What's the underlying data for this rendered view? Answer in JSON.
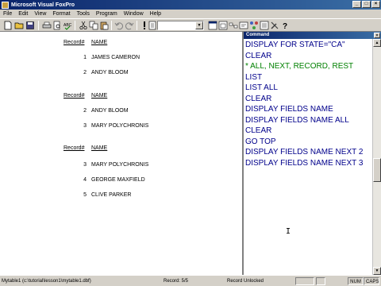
{
  "titlebar": {
    "title": "Microsoft Visual FoxPro"
  },
  "menubar": {
    "items": [
      "File",
      "Edit",
      "View",
      "Format",
      "Tools",
      "Program",
      "Window",
      "Help"
    ]
  },
  "output": {
    "header_record": "Record#",
    "header_name": "NAME",
    "blocks": [
      {
        "rows": [
          {
            "num": "1",
            "name": "JAMES CAMERON"
          },
          {
            "num": "2",
            "name": "ANDY BLOOM"
          }
        ]
      },
      {
        "rows": [
          {
            "num": "2",
            "name": "ANDY BLOOM"
          },
          {
            "num": "3",
            "name": "MARY POLYCHRONIS"
          }
        ]
      },
      {
        "rows": [
          {
            "num": "3",
            "name": "MARY POLYCHRONIS"
          },
          {
            "num": "4",
            "name": "GEORGE MAXFIELD"
          },
          {
            "num": "5",
            "name": "CLIVE PARKER"
          }
        ]
      }
    ]
  },
  "command_window": {
    "title": "Command",
    "lines": [
      "DISPLAY FOR STATE=\"CA\"",
      "CLEAR",
      "* ALL, NEXT, RECORD, REST",
      "LIST",
      "LIST ALL",
      "CLEAR",
      "DISPLAY FIELDS NAME",
      "DISPLAY FIELDS NAME ALL",
      "CLEAR",
      "GO TOP",
      "DISPLAY FIELDS NAME NEXT 2",
      "DISPLAY FIELDS NAME NEXT 3"
    ]
  },
  "statusbar": {
    "table": "Mytable1 (c:\\tutorial\\lesson1\\mytable1.dbf)",
    "record": "Record: 5/5",
    "lock": "Record Unlocked",
    "num": "NUM",
    "caps": "CAPS"
  },
  "colors": {
    "command_text": "#00008b",
    "comment_text": "#008000",
    "titlebar": "#0a246a"
  }
}
